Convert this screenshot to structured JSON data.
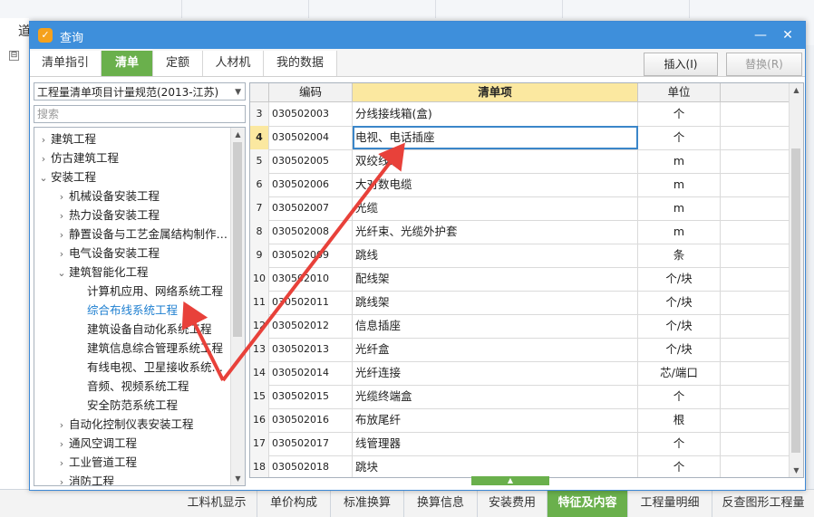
{
  "background": {
    "partial_title": "道",
    "expand_glyph": "⊟"
  },
  "dialog": {
    "title": "查询",
    "icon": "app-logo-icon",
    "minimize_icon": "minimize-icon",
    "close_icon": "close-icon",
    "tabs": [
      "清单指引",
      "清单",
      "定额",
      "人材机",
      "我的数据"
    ],
    "active_tab": "清单",
    "insert_label": "插入(I)",
    "replace_label": "替换(R)",
    "spec_select": "工程量清单项目计量规范(2013-江苏)",
    "search_placeholder": "搜索"
  },
  "tree": [
    {
      "label": "建筑工程",
      "level": 0,
      "expanded": false
    },
    {
      "label": "仿古建筑工程",
      "level": 0,
      "expanded": false
    },
    {
      "label": "安装工程",
      "level": 0,
      "expanded": true
    },
    {
      "label": "机械设备安装工程",
      "level": 1,
      "expanded": false
    },
    {
      "label": "热力设备安装工程",
      "level": 1,
      "expanded": false
    },
    {
      "label": "静置设备与工艺金属结构制作…",
      "level": 1,
      "expanded": false
    },
    {
      "label": "电气设备安装工程",
      "level": 1,
      "expanded": false
    },
    {
      "label": "建筑智能化工程",
      "level": 1,
      "expanded": true
    },
    {
      "label": "计算机应用、网络系统工程",
      "level": 2,
      "leaf": true
    },
    {
      "label": "综合布线系统工程",
      "level": 2,
      "leaf": true,
      "selected": true
    },
    {
      "label": "建筑设备自动化系统工程",
      "level": 2,
      "leaf": true
    },
    {
      "label": "建筑信息综合管理系统工程",
      "level": 2,
      "leaf": true
    },
    {
      "label": "有线电视、卫星接收系统…",
      "level": 2,
      "leaf": true
    },
    {
      "label": "音频、视频系统工程",
      "level": 2,
      "leaf": true
    },
    {
      "label": "安全防范系统工程",
      "level": 2,
      "leaf": true
    },
    {
      "label": "自动化控制仪表安装工程",
      "level": 1,
      "expanded": false
    },
    {
      "label": "通风空调工程",
      "level": 1,
      "expanded": false
    },
    {
      "label": "工业管道工程",
      "level": 1,
      "expanded": false
    },
    {
      "label": "消防工程",
      "level": 1,
      "expanded": false
    }
  ],
  "grid": {
    "headers": [
      "",
      "编码",
      "清单项",
      "单位"
    ],
    "rows": [
      {
        "no": "3",
        "code": "030502003",
        "name": "分线接线箱(盒)",
        "unit": "个"
      },
      {
        "no": "4",
        "code": "030502004",
        "name": "电视、电话插座",
        "unit": "个",
        "active": true
      },
      {
        "no": "5",
        "code": "030502005",
        "name": "双绞线缆",
        "unit": "m"
      },
      {
        "no": "6",
        "code": "030502006",
        "name": "大对数电缆",
        "unit": "m"
      },
      {
        "no": "7",
        "code": "030502007",
        "name": "光缆",
        "unit": "m"
      },
      {
        "no": "8",
        "code": "030502008",
        "name": "光纤束、光缆外护套",
        "unit": "m"
      },
      {
        "no": "9",
        "code": "030502009",
        "name": "跳线",
        "unit": "条"
      },
      {
        "no": "10",
        "code": "030502010",
        "name": "配线架",
        "unit": "个/块"
      },
      {
        "no": "11",
        "code": "030502011",
        "name": "跳线架",
        "unit": "个/块"
      },
      {
        "no": "12",
        "code": "030502012",
        "name": "信息插座",
        "unit": "个/块"
      },
      {
        "no": "13",
        "code": "030502013",
        "name": "光纤盒",
        "unit": "个/块"
      },
      {
        "no": "14",
        "code": "030502014",
        "name": "光纤连接",
        "unit": "芯/端口"
      },
      {
        "no": "15",
        "code": "030502015",
        "name": "光缆终端盒",
        "unit": "个"
      },
      {
        "no": "16",
        "code": "030502016",
        "name": "布放尾纤",
        "unit": "根"
      },
      {
        "no": "17",
        "code": "030502017",
        "name": "线管理器",
        "unit": "个"
      },
      {
        "no": "18",
        "code": "030502018",
        "name": "跳块",
        "unit": "个"
      }
    ]
  },
  "bottom_tabs": [
    "工料机显示",
    "单价构成",
    "标准换算",
    "换算信息",
    "安装费用",
    "特征及内容",
    "工程量明细",
    "反查图形工程量"
  ],
  "bottom_active": "特征及内容",
  "colors": {
    "accent_green": "#6ab04c",
    "title_blue": "#3e8fdb",
    "annotation_red": "#e8413a",
    "selected_text": "#1e7fd0"
  }
}
